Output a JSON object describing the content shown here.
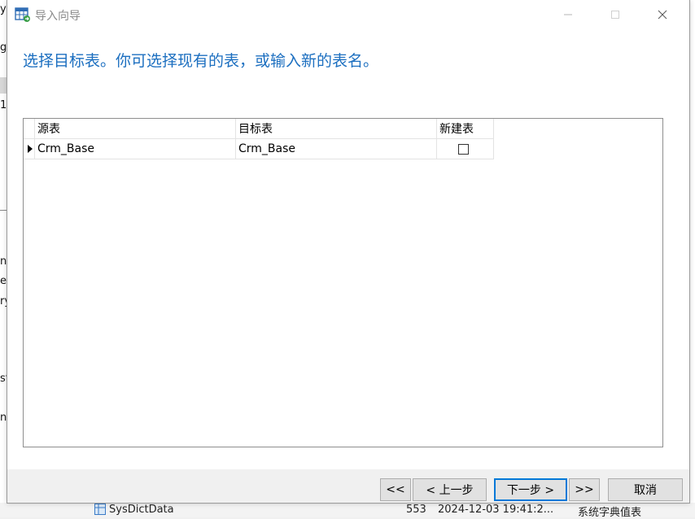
{
  "window": {
    "title": "导入向导"
  },
  "heading": "选择目标表。你可选择现有的表，或输入新的表名。",
  "grid": {
    "columns": [
      "源表",
      "目标表",
      "新建表"
    ],
    "rows": [
      {
        "source": "Crm_Base",
        "target": "Crm_Base",
        "new_table": false
      }
    ]
  },
  "buttons": {
    "first": "<<",
    "prev": "< 上一步",
    "next": "下一步 >",
    "last": ">>",
    "cancel": "取消"
  },
  "background": {
    "left_fragments": [
      "y",
      "g",
      "1",
      "n",
      "er",
      "ry",
      "st",
      "n"
    ],
    "bottom_row": {
      "name": "SysDictData",
      "count": "553",
      "date": "2024-12-03 19:41:2...",
      "desc": "系统字典值表"
    }
  },
  "colors": {
    "heading": "#1c6fc0",
    "accent": "#0078d7",
    "footer": "#f0f0f0"
  }
}
